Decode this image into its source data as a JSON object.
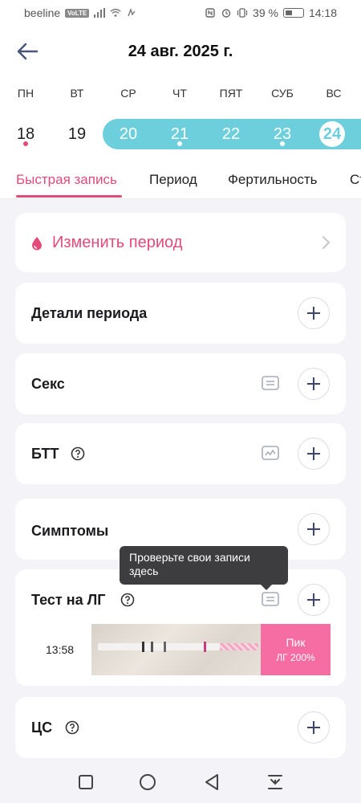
{
  "status_bar": {
    "carrier": "beeline",
    "volte": "VoLTE",
    "battery": "39 %",
    "time": "14:18"
  },
  "header": {
    "title": "24 авг. 2025 г."
  },
  "week": {
    "weekdays": [
      "ПН",
      "ВТ",
      "СР",
      "ЧТ",
      "ПЯТ",
      "СУБ",
      "ВС"
    ],
    "days": [
      "18",
      "19",
      "20",
      "21",
      "22",
      "23",
      "24"
    ]
  },
  "tabs": [
    "Быстрая запись",
    "Период",
    "Фертильность",
    "Ст"
  ],
  "cards": {
    "change_period": "Изменить период",
    "period_details": "Детали периода",
    "sex": "Секс",
    "bbt": "БТТ",
    "symptoms": "Симптомы",
    "lh_test": "Тест на ЛГ",
    "cm": "ЦС"
  },
  "lh_entry": {
    "time": "13:58",
    "result_line1": "Пик",
    "result_line2": "ЛГ 200%"
  },
  "tooltip": {
    "text": "Проверьте свои записи здесь"
  },
  "colors": {
    "accent_pink": "#e24b7a",
    "period_teal": "#6ecfdc",
    "lh_peak_pink": "#f56da2"
  }
}
